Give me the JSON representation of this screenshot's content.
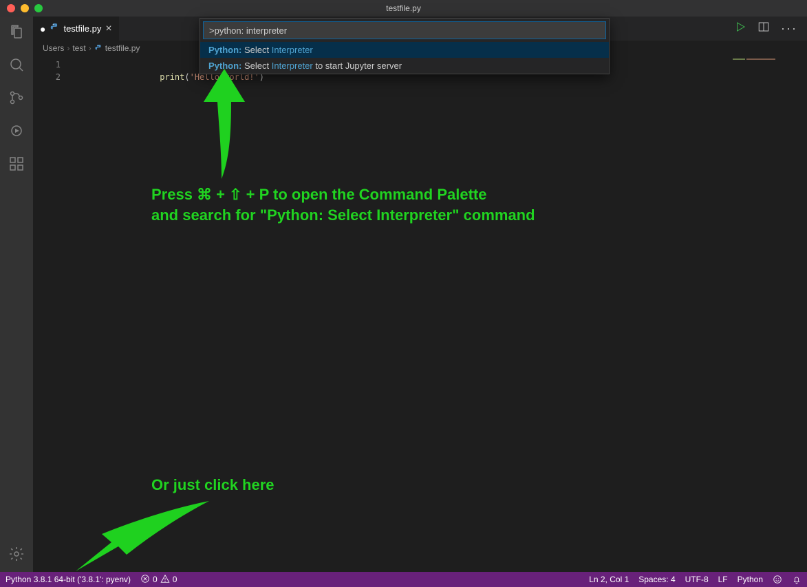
{
  "title": "testfile.py",
  "tab": {
    "filename": "testfile.py",
    "dirty": "●",
    "close": "×"
  },
  "breadcrumbs": {
    "seg1": "Users",
    "seg2": "test",
    "seg3": "testfile.py",
    "sep": "›"
  },
  "editor": {
    "line_numbers": [
      "1",
      "2"
    ],
    "line1_fn": "print",
    "line1_paren_open": "(",
    "line1_str": "'Hello world!'",
    "line1_paren_close": ")"
  },
  "palette": {
    "input_value": ">python: interpreter",
    "items": [
      {
        "prefix": "Python:",
        "mid": " Select ",
        "match": "Interpreter",
        "suffix": ""
      },
      {
        "prefix": "Python:",
        "mid": " Select ",
        "match": "Interpreter",
        "suffix": " to start Jupyter server"
      }
    ]
  },
  "statusbar": {
    "interpreter": "Python 3.8.1 64-bit ('3.8.1': pyenv)",
    "errors": "0",
    "warnings": "0",
    "cursor": "Ln 2, Col 1",
    "spaces": "Spaces: 4",
    "encoding": "UTF-8",
    "eol": "LF",
    "language": "Python"
  },
  "annotations": {
    "line1": "Press ⌘ + ⇧ + P to open the Command Palette",
    "line2": "and search for \"Python: Select Interpreter\" command",
    "line3": "Or just click here"
  }
}
